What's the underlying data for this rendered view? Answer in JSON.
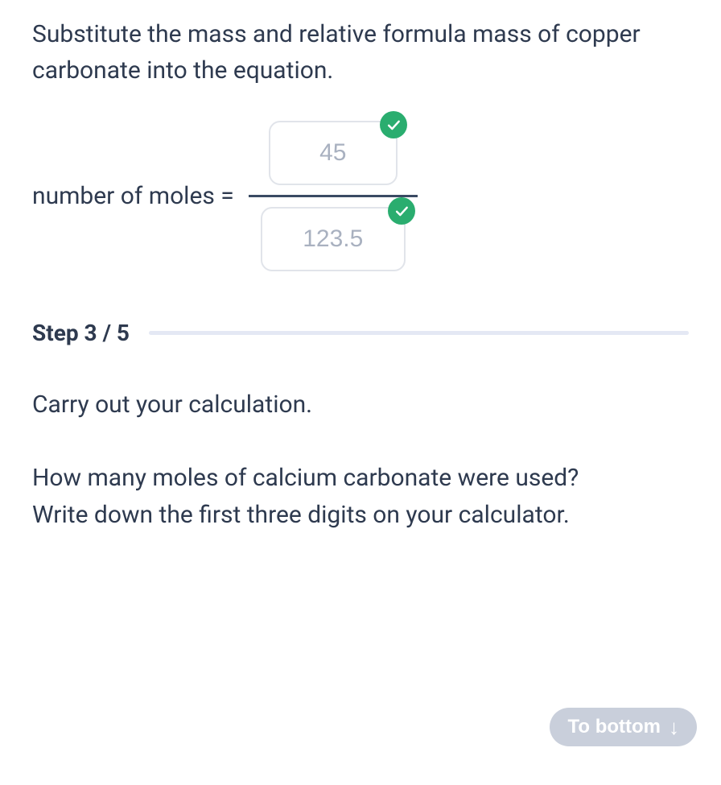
{
  "instruction": "Substitute the mass and relative formula mass of copper carbonate into the equation.",
  "equation": {
    "label": "number of moles =",
    "numerator": "45",
    "denominator": "123.5"
  },
  "step": {
    "label": "Step 3 / 5",
    "line1": "Carry out your calculation.",
    "line2": "How many moles of calcium carbonate were used?",
    "line3": "Write down the first three digits on your calculator."
  },
  "to_bottom": {
    "label": "To bottom",
    "arrow": "↓"
  }
}
